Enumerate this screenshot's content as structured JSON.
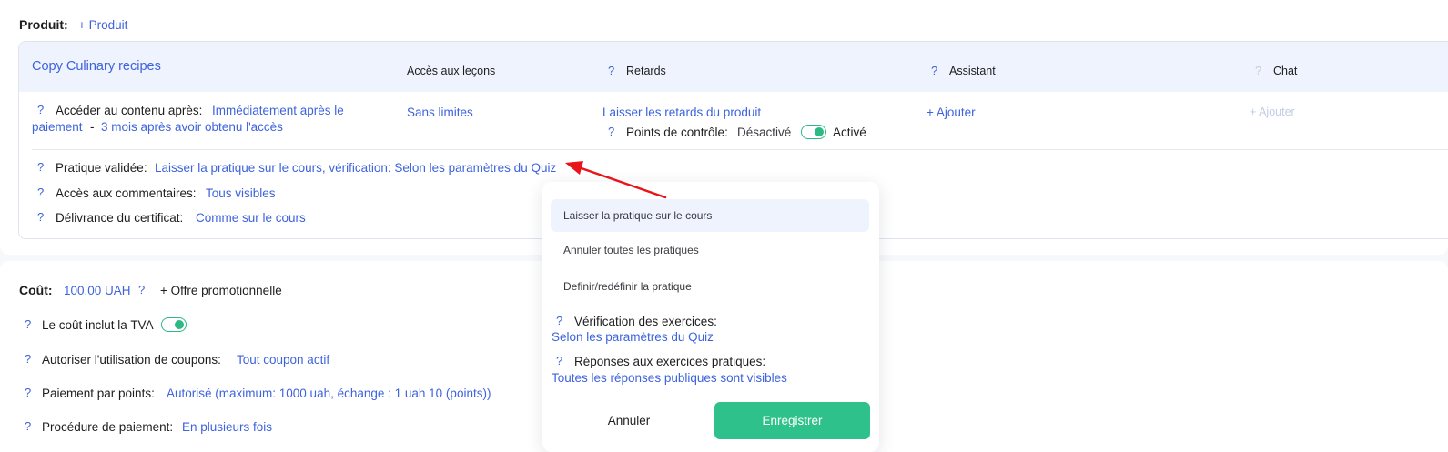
{
  "product_section": {
    "label": "Produit:",
    "add_link": "+ Produit",
    "card": {
      "title": "Copy Culinary recipes",
      "columns": {
        "lessons_access": "Accès aux leçons",
        "delays": "Retards",
        "assistant": "Assistant",
        "chat": "Chat"
      },
      "help_mark": "?",
      "access_after_label": "Accéder au contenu après:",
      "access_after_value_1a": "Immédiatement après le",
      "access_after_value_1b": "paiement",
      "access_sep": "-",
      "access_after_value_2": "3 mois après avoir obtenu l'accès",
      "lessons_value": "Sans limites",
      "delays_value": "Laisser les retards du produit",
      "checkpoints_label": "Points de contrôle:",
      "checkpoints_off": "Désactivé",
      "checkpoints_on": "Activé",
      "assistant_add": "+ Ajouter",
      "chat_add": "+ Ajouter",
      "practice_label": "Pratique validée:",
      "practice_value": "Laisser la pratique sur le cours, vérification: Selon les paramètres du Quiz",
      "comments_label": "Accès aux commentaires:",
      "comments_value": "Tous visibles",
      "certificate_label": "Délivrance du certificat:",
      "certificate_value": "Comme sur le cours"
    }
  },
  "cost_section": {
    "label": "Coût:",
    "value": "100.00 UAH",
    "promo": "+ Offre promotionnelle",
    "help_mark": "?",
    "vat_label": "Le coût inclut la TVA",
    "coupons_label": "Autoriser l'utilisation de coupons:",
    "coupons_value": "Tout coupon actif",
    "points_label": "Paiement par points:",
    "points_value": "Autorisé (maximum: 1000 uah, échange : 1 uah 10 (points))",
    "procedure_label": "Procédure de paiement:",
    "procedure_value": "En plusieurs fois"
  },
  "dropdown": {
    "options": [
      "Laisser la pratique sur le cours",
      "Annuler toutes les pratiques",
      "Definir/redéfinir la pratique"
    ],
    "help_mark": "?",
    "check_label": "Vérification des exercices:",
    "check_value": "Selon les paramètres du Quiz",
    "answers_label": "Réponses aux exercices pratiques:",
    "answers_value": "Toutes les réponses publiques sont visibles",
    "cancel": "Annuler",
    "save": "Enregistrer"
  },
  "colors": {
    "link": "#3d63dd",
    "accent_green": "#2ec18c",
    "annotation_arrow": "#e8141a"
  }
}
